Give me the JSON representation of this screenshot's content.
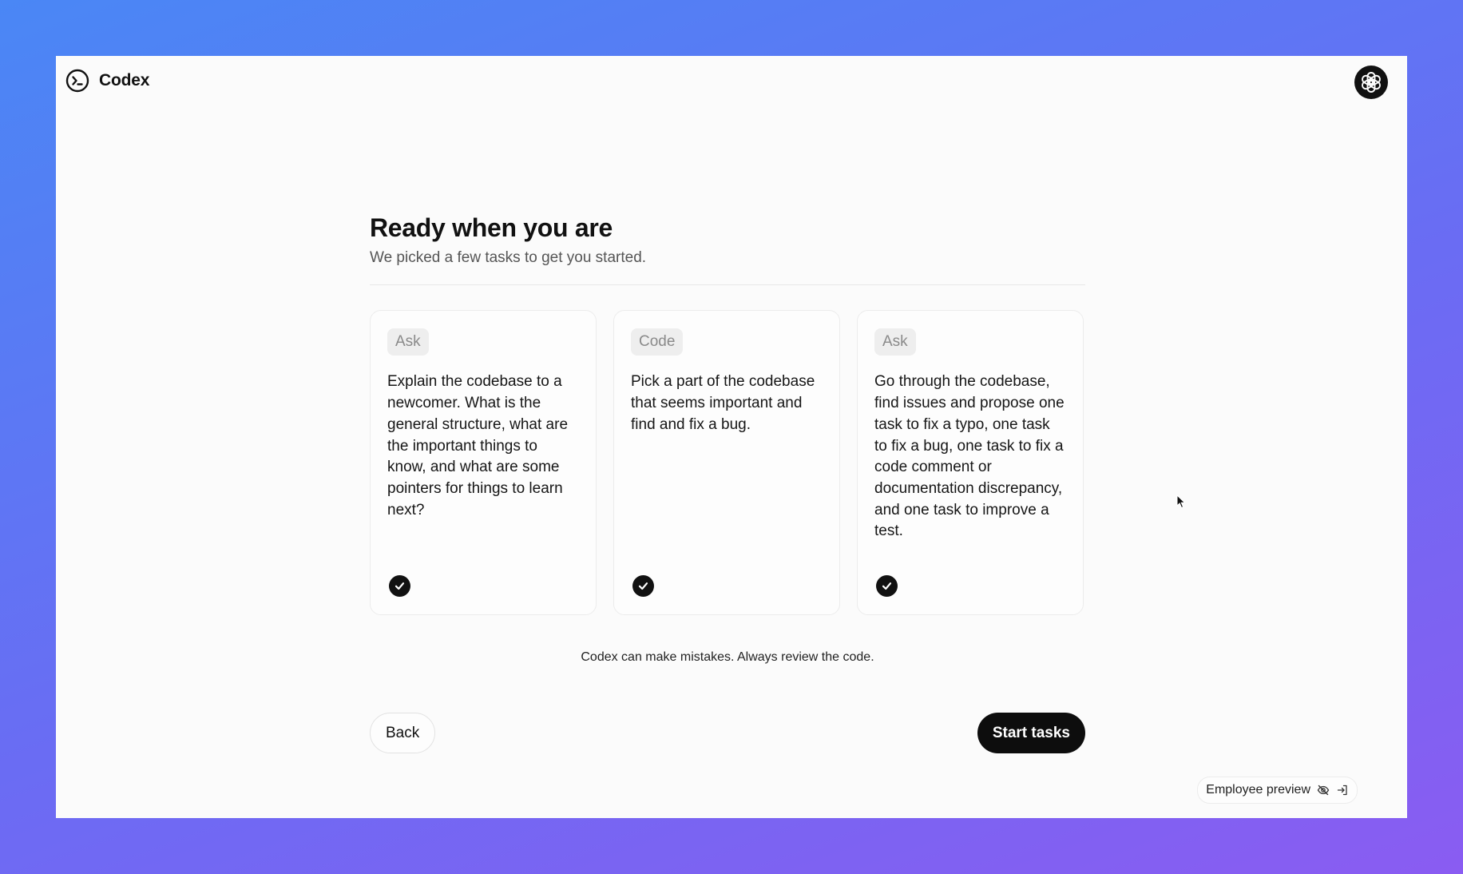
{
  "app": {
    "name": "Codex",
    "logo_icon": "terminal-circle-icon",
    "avatar_icon": "openai-logo-icon"
  },
  "onboarding": {
    "title": "Ready when you are",
    "subtitle": "We picked a few tasks to get you started."
  },
  "cards": [
    {
      "tag": "Ask",
      "text": "Explain the codebase to a newcomer. What is the general structure, what are the important things to know, and what are some pointers for things to learn next?",
      "selected": true
    },
    {
      "tag": "Code",
      "text": "Pick a part of the codebase that seems important and find and fix a bug.",
      "selected": true
    },
    {
      "tag": "Ask",
      "text": "Go through the codebase, find issues and propose one task to fix a typo, one task to fix a bug, one task to fix a code comment or documentation discrepancy, and one task to improve a test.",
      "selected": true
    }
  ],
  "disclaimer": "Codex can make mistakes. Always review the code.",
  "actions": {
    "back_label": "Back",
    "start_label": "Start tasks"
  },
  "employee_preview": {
    "label": "Employee preview",
    "icons": [
      "eye-off-icon",
      "sign-in-icon"
    ]
  },
  "colors": {
    "background_gradient_start": "#4a87f5",
    "background_gradient_end": "#8a5cf2",
    "window_bg": "#fbfbfb",
    "primary_button": "#0d0d0d",
    "tag_bg": "#eeeeee",
    "tag_text": "#8a8a8a"
  }
}
